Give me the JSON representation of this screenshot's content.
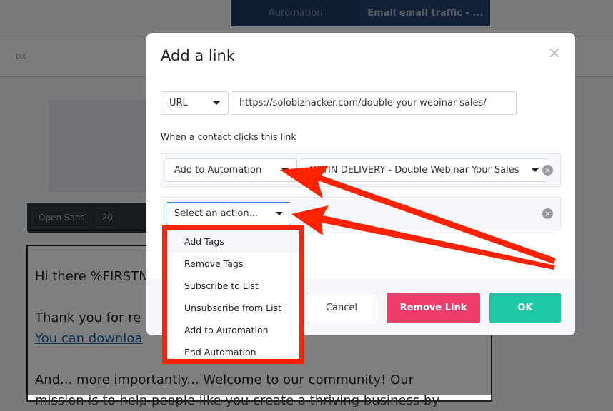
{
  "nav": {
    "crumb1": "Automation",
    "crumb2": "Email email traffic - ..."
  },
  "editor": {
    "font": "Open Sans",
    "size": "20",
    "unit": "px",
    "lines": [
      "Hi there %FIRSTN",
      "Thank you for re",
      "You can downloa",
      "And... more importantly... Welcome to our community!  Our",
      "mission is to help people like you create a thriving business by"
    ]
  },
  "modal": {
    "title": "Add a link",
    "close": "×",
    "link_type": "URL",
    "url": "https://solobizhacker.com/double-your-webinar-sales/",
    "when_label": "When a contact clicks this link",
    "action1": "Add to Automation",
    "action1_target": "OPTIN DELIVERY - Double Webinar Your Sales",
    "action2_placeholder": "Select an action...",
    "cancel": "Cancel",
    "remove": "Remove Link",
    "ok": "OK"
  },
  "dropdown": [
    "Add Tags",
    "Remove Tags",
    "Subscribe to List",
    "Unsubscribe from List",
    "Add to Automation",
    "End Automation"
  ],
  "colors": {
    "annotation": "#ff2200",
    "remove": "#ef3d6c",
    "ok": "#1fc8a4"
  }
}
